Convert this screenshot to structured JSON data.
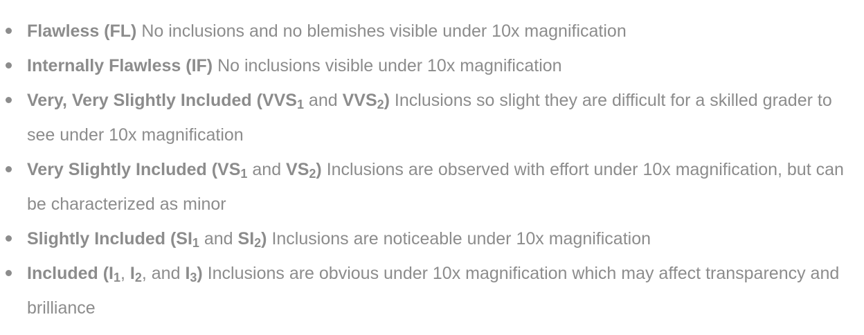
{
  "clarity_list": {
    "items": [
      {
        "grade": "Flawless (FL)",
        "description": "No inclusions and no blemishes visible under 10x magnification"
      },
      {
        "grade": "Internally Flawless (IF)",
        "description": "No inclusions visible under 10x magnification"
      },
      {
        "grade_prefix": "Very, Very Slightly Included (VVS",
        "sub1": "1",
        "joiner": " and ",
        "abbr2": "VVS",
        "sub2": "2",
        "grade_suffix": ")",
        "description": "Inclusions so slight they are difficult for a skilled grader to see under 10x magnification"
      },
      {
        "grade_prefix": "Very Slightly Included (VS",
        "sub1": "1",
        "joiner": " and ",
        "abbr2": "VS",
        "sub2": "2",
        "grade_suffix": ")",
        "description": "Inclusions are observed with effort under 10x magnification, but can be characterized as minor"
      },
      {
        "grade_prefix": "Slightly Included (SI",
        "sub1": "1",
        "joiner": " and ",
        "abbr2": "SI",
        "sub2": "2",
        "grade_suffix": ")",
        "description": "Inclusions are noticeable under 10x magnification"
      },
      {
        "grade_prefix": "Included (I",
        "sub1": "1",
        "sep1": ", ",
        "abbr2": "I",
        "sub2": "2",
        "sep2": ", and ",
        "abbr3": "I",
        "sub3": "3",
        "grade_suffix": ")",
        "description": "Inclusions are obvious under 10x magnification which may affect transparency and brilliance"
      }
    ]
  }
}
